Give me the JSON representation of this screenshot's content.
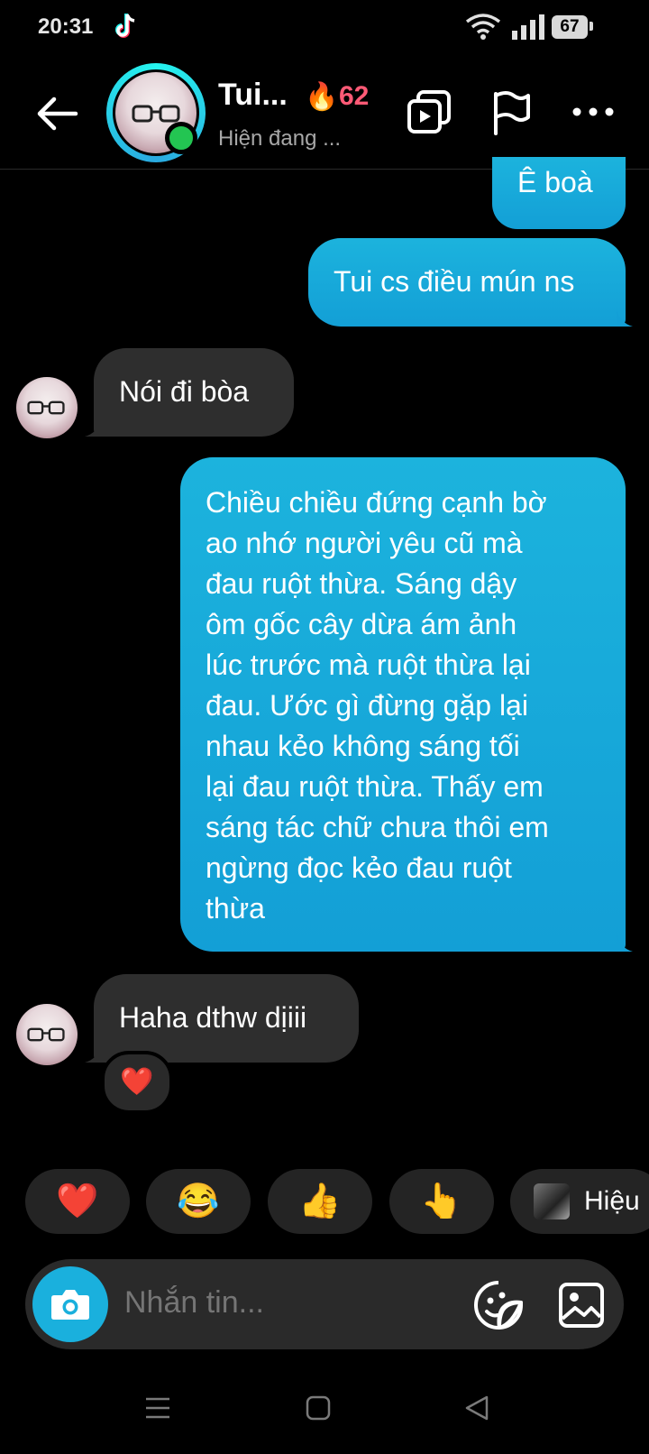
{
  "status_bar": {
    "time": "20:31",
    "battery": "67"
  },
  "header": {
    "contact_name": "Tui...",
    "streak_count": "62",
    "status": "Hiện đang ..."
  },
  "messages": [
    {
      "direction": "out",
      "text": "Ê boà"
    },
    {
      "direction": "out",
      "text": "Tui cs điều mún ns"
    },
    {
      "direction": "in",
      "text": "Nói đi bòa"
    },
    {
      "direction": "out",
      "text": "Chiều chiều đứng cạnh bờ\nao nhớ người yêu cũ mà\nđau ruột thừa. Sáng dậy\nôm gốc cây dừa ám ảnh\nlúc trước mà ruột thừa lại\nđau. Ước gì đừng gặp lại\nnhau kẻo không sáng tối\nlại đau ruột thừa. Thấy em\nsáng tác chữ chưa thôi em\nngừng đọc kẻo đau ruột\nthừa"
    },
    {
      "direction": "in",
      "text": "Haha dthw dịiii",
      "reaction": "❤️"
    }
  ],
  "quick_reactions": [
    "❤️",
    "😂",
    "👍",
    "👆",
    "Hiệu"
  ],
  "composer": {
    "placeholder": "Nhắn tin..."
  },
  "colors": {
    "outgoing_bubble": "#1cb3dd",
    "incoming_bubble": "#2e2e2e",
    "streak": "#ff5a76",
    "online": "#23c552"
  }
}
